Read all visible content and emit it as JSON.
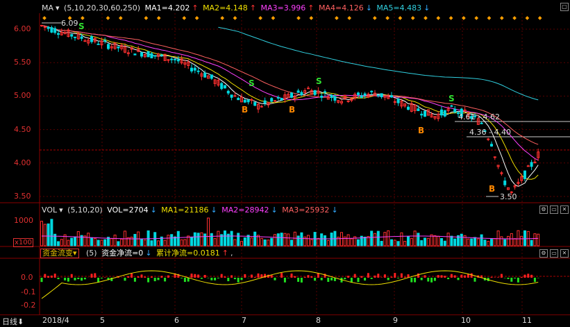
{
  "main": {
    "indicator": "MA",
    "params": "(5,10,20,30,60,250)",
    "ma1": "MA1=4.202",
    "ma2": "MA2=4.148",
    "ma3": "MA3=3.996",
    "ma4": "MA4=4.126",
    "ma5": "MA5=4.483",
    "yticks": [
      "6.00",
      "5.50",
      "5.00",
      "4.50",
      "4.00",
      "3.50"
    ],
    "high_label": "6.09",
    "low_label": "3.50",
    "band1": "4.61 - 4.62",
    "band2": "4.36 - 4.40",
    "buy": "B",
    "sell": "S"
  },
  "vol": {
    "indicator": "VOL",
    "params": "(5,10,20)",
    "vol": "VOL=2704",
    "ma1": "MA1=21186",
    "ma2": "MA2=28942",
    "ma3": "MA3=25932",
    "ytick": "1000",
    "unit": "x100"
  },
  "fund": {
    "name": "资金流变",
    "params": "(5)",
    "net": "资金净流=0",
    "cum": "累计净流=0.0181",
    "yticks": [
      "0.0",
      "-0.1",
      "-0.2"
    ]
  },
  "xaxis": {
    "period": "日线",
    "labels": [
      "2018/4",
      "5",
      "6",
      "7",
      "8",
      "9",
      "10",
      "11"
    ]
  },
  "colors": {
    "up": "#ff3030",
    "down": "#00d8e0",
    "ma1": "#ffffff",
    "ma2": "#f0e000",
    "ma3": "#ff40ff",
    "ma4": "#ff6060",
    "ma5": "#30d0e0"
  }
}
